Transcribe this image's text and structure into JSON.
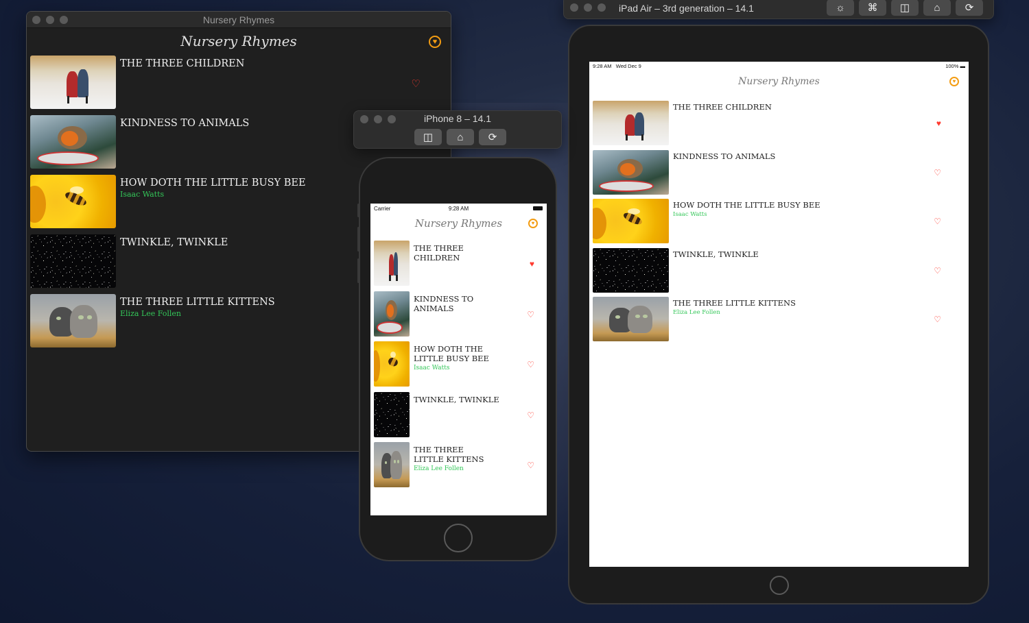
{
  "app": {
    "name": "Nursery Rhymes",
    "favorites_glyph": "♥",
    "heart_filled": "♥",
    "heart_empty": "♡"
  },
  "colors": {
    "accent_orange": "#f39c12",
    "heart_red": "#ff3b30",
    "author_green": "#34c759"
  },
  "mac_window": {
    "title": "Nursery Rhymes",
    "hearts": [
      "♡",
      "♥",
      "",
      "",
      ""
    ]
  },
  "iphone_sim": {
    "title": "iPhone 8 – 14.1",
    "toolbar_icons": [
      "screenshot-icon",
      "home-icon",
      "rotate-icon"
    ],
    "toolbar_glyphs": [
      "◫",
      "⌂",
      "⟳"
    ],
    "status": {
      "carrier": "Carrier",
      "time": "9:28 AM"
    },
    "titles": [
      "THE THREE CHILDREN",
      "KINDNESS TO ANIMALS",
      "HOW DOTH THE LITTLE BUSY BEE",
      "TWINKLE, TWINKLE",
      "THE THREE LITTLE KITTENS"
    ],
    "hearts": [
      "♥",
      "♡",
      "♡",
      "♡",
      "♡"
    ]
  },
  "ipad_sim": {
    "title": "iPad Air – 3rd generation – 14.1",
    "toolbar_icons": [
      "brightness-icon",
      "command-icon",
      "screenshot-icon",
      "home-icon",
      "rotate-icon"
    ],
    "toolbar_glyphs": [
      "☼",
      "⌘",
      "◫",
      "⌂",
      "⟳"
    ],
    "status": {
      "time": "9:28 AM",
      "date": "Wed Dec 9",
      "battery": "100%"
    },
    "hearts": [
      "♥",
      "♡",
      "♡",
      "♡",
      "♡"
    ]
  },
  "rhymes": [
    {
      "title": "THE THREE CHILDREN",
      "author": ""
    },
    {
      "title": "KINDNESS TO ANIMALS",
      "author": ""
    },
    {
      "title": "HOW DOTH THE LITTLE BUSY BEE",
      "author": "Isaac Watts"
    },
    {
      "title": "TWINKLE, TWINKLE",
      "author": ""
    },
    {
      "title": "THE THREE LITTLE KITTENS",
      "author": "Eliza Lee Follen"
    }
  ]
}
